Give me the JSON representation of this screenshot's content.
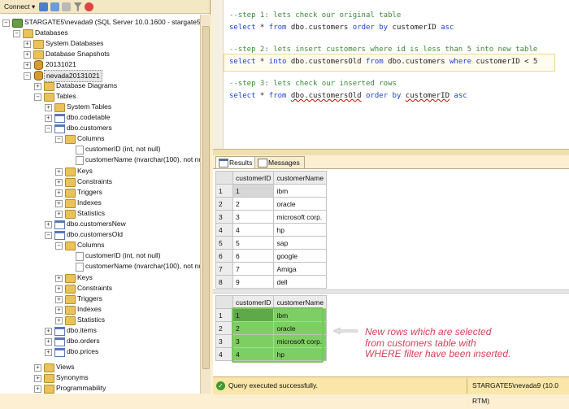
{
  "toolbar": {
    "connect_label": "Connect",
    "dropdown_glyph": "▾"
  },
  "tree": {
    "server": "STARGATE5\\nevada9 (SQL Server 10.0.1600 - stargate5\\peta)",
    "databases": "Databases",
    "system_databases": "System Databases",
    "database_snapshots": "Database Snapshots",
    "db1": "20131021",
    "db2": "nevada20131021",
    "database_diagrams": "Database Diagrams",
    "tables": "Tables",
    "system_tables": "System Tables",
    "codetable": "dbo.codetable",
    "customers": "dbo.customers",
    "columns": "Columns",
    "col_customer_id": "customerID (int, not null)",
    "col_customer_name": "customerName (nvarchar(100), not null)",
    "keys": "Keys",
    "constraints": "Constraints",
    "triggers": "Triggers",
    "indexes": "Indexes",
    "statistics": "Statistics",
    "customers_new": "dbo.customersNew",
    "customers_old": "dbo.customersOld",
    "items": "dbo.items",
    "orders": "dbo.orders",
    "prices": "dbo.prices",
    "views": "Views",
    "synonyms": "Synonyms",
    "programmability": "Programmability",
    "plus": "+",
    "minus": "−"
  },
  "editor": {
    "step1_comment": "--step 1: lets check our original table",
    "step1_sql": {
      "kw1": "select",
      "star": " * ",
      "kw2": "from",
      "tbl": " dbo.customers ",
      "kw3": "order by",
      "col": " customerID ",
      "kw4": "asc"
    },
    "step2_comment": "--step 2: lets insert customers where id is less than 5 into new table",
    "step2_sql": {
      "kw1": "select",
      "star": " * ",
      "kw2": "into",
      "tbl": " dbo.customersOld ",
      "kw3": "from",
      "src": " dbo.customers ",
      "kw4": "where",
      "cond": " customerID < 5"
    },
    "step3_comment": "--step 3: lets check our inserted rows",
    "step3_sql": {
      "kw1": "select",
      "star": " * ",
      "kw2": "from",
      "tbl": "dbo.customersOld",
      "kw3": "order by",
      "col": "customerID",
      "kw4": "asc"
    }
  },
  "tabs": {
    "results": "Results",
    "messages": "Messages"
  },
  "grid_headers": {
    "id": "customerID",
    "name": "customerName"
  },
  "grid1_rows": [
    {
      "n": "1",
      "id": "1",
      "name": "ibm"
    },
    {
      "n": "2",
      "id": "2",
      "name": "oracle"
    },
    {
      "n": "3",
      "id": "3",
      "name": "microsoft corp."
    },
    {
      "n": "4",
      "id": "4",
      "name": "hp"
    },
    {
      "n": "5",
      "id": "5",
      "name": "sap"
    },
    {
      "n": "6",
      "id": "6",
      "name": "google"
    },
    {
      "n": "7",
      "id": "7",
      "name": "Amiga"
    },
    {
      "n": "8",
      "id": "9",
      "name": "dell"
    }
  ],
  "grid2_rows": [
    {
      "n": "1",
      "id": "1",
      "name": "ibm"
    },
    {
      "n": "2",
      "id": "2",
      "name": "oracle"
    },
    {
      "n": "3",
      "id": "3",
      "name": "microsoft corp."
    },
    {
      "n": "4",
      "id": "4",
      "name": "hp"
    }
  ],
  "annotation": {
    "line1": "New rows which are selected",
    "line2": "from customers table with",
    "line3": "WHERE filter have been inserted."
  },
  "status": {
    "message": "Query executed successfully.",
    "server": "STARGATE5\\nevada9 (10.0 RTM)",
    "ok_glyph": "✓"
  },
  "colors": {
    "highlight_green": "#7ecf63",
    "annotation_red": "#d84058",
    "comment_green": "#3d8a3a",
    "keyword_blue": "#1b3fd6"
  }
}
